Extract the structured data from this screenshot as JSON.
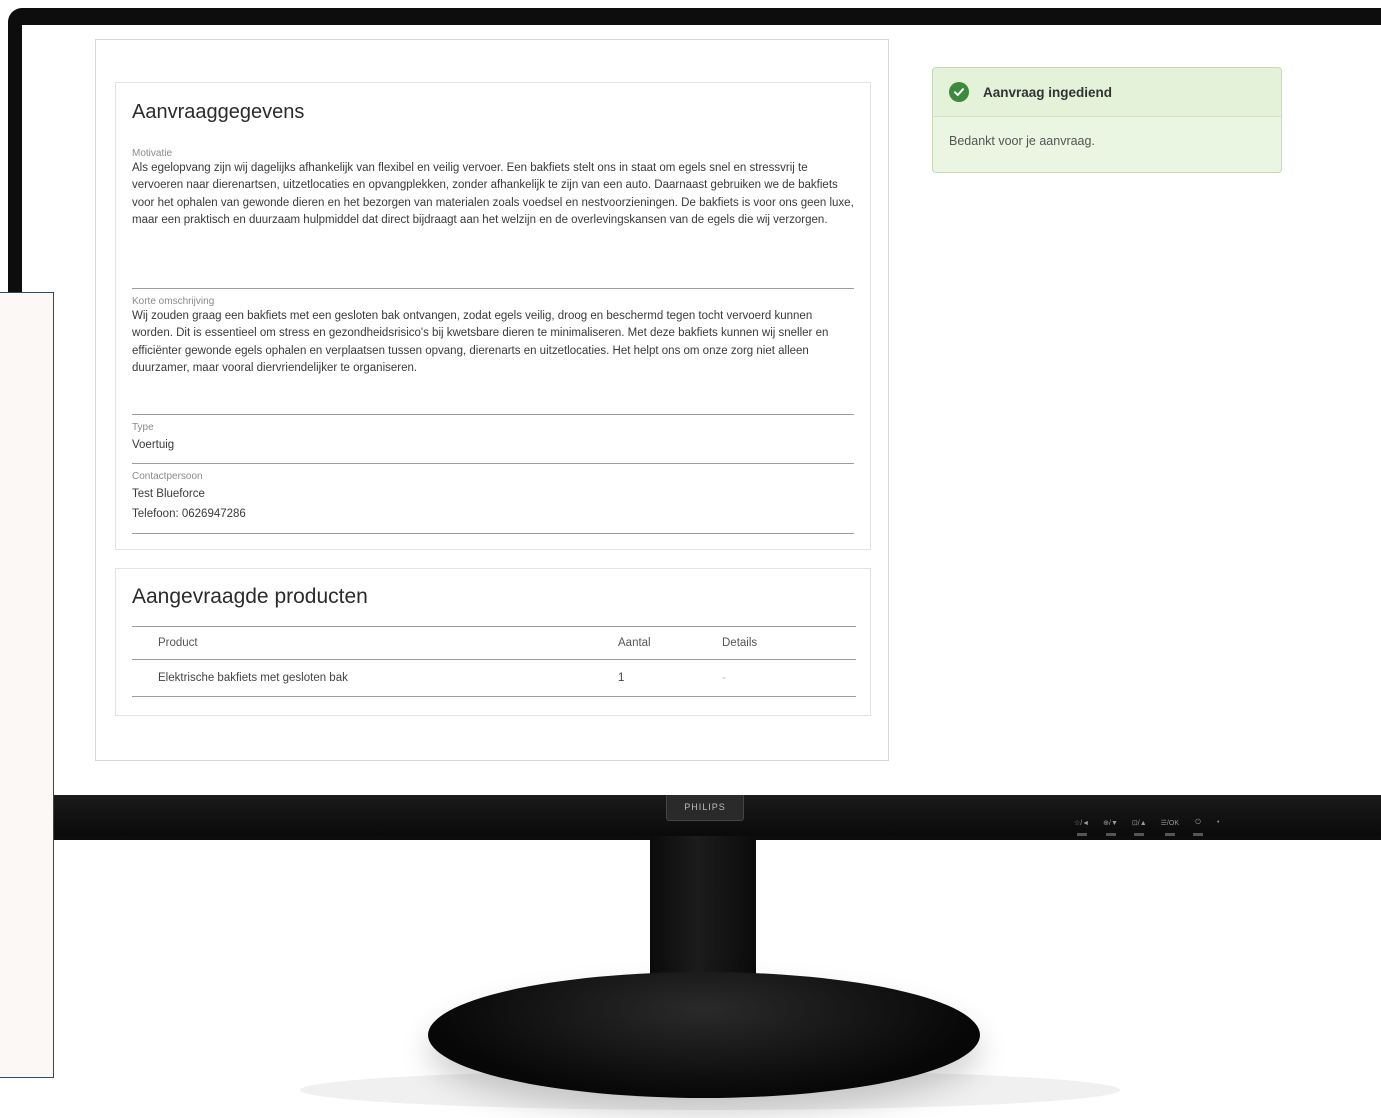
{
  "monitor": {
    "brand": "PHILIPS",
    "osd_keys": [
      "☆/◄",
      "⊕/▼",
      "⊡/▲",
      "☰/OK",
      "⏻",
      "•"
    ]
  },
  "details": {
    "title": "Aanvraaggegevens",
    "motivation": {
      "label": "Motivatie",
      "value": "Als egelopvang zijn wij dagelijks afhankelijk van flexibel en veilig vervoer. Een bakfiets stelt ons in staat om egels snel en stressvrij te vervoeren naar dierenartsen, uitzetlocaties en opvangplekken, zonder afhankelijk te zijn van een auto. Daarnaast gebruiken we de bakfiets voor het ophalen van gewonde dieren en het bezorgen van materialen zoals voedsel en nestvoorzieningen. De bakfiets is voor ons geen luxe, maar een praktisch en duurzaam hulpmiddel dat direct bijdraagt aan het welzijn en de overlevingskansen van de egels die wij verzorgen."
    },
    "short_description": {
      "label": "Korte omschrijving",
      "value": "Wij zouden graag een bakfiets met een gesloten bak ontvangen, zodat egels veilig, droog en beschermd tegen tocht vervoerd kunnen worden. Dit is essentieel om stress en gezondheidsrisico's bij kwetsbare dieren te minimaliseren. Met deze bakfiets kunnen wij sneller en efficiënter gewonde egels ophalen en verplaatsen tussen opvang, dierenarts en uitzetlocaties. Het helpt ons om onze zorg niet alleen duurzamer, maar vooral diervriendelijker te organiseren."
    },
    "type": {
      "label": "Type",
      "value": "Voertuig"
    },
    "contact": {
      "label": "Contactpersoon",
      "name": "Test Blueforce",
      "phone": "Telefoon: 0626947286"
    }
  },
  "products": {
    "title": "Aangevraagde producten",
    "columns": [
      "Product",
      "Aantal",
      "Details"
    ],
    "rows": [
      {
        "product": "Elektrische bakfiets met gesloten bak",
        "quantity": "1",
        "details": "-"
      }
    ]
  },
  "toast": {
    "title": "Aanvraag ingediend",
    "message": "Bedankt voor je aanvraag.",
    "accent": "#3c8a3c",
    "icon": "check-circle-icon"
  }
}
